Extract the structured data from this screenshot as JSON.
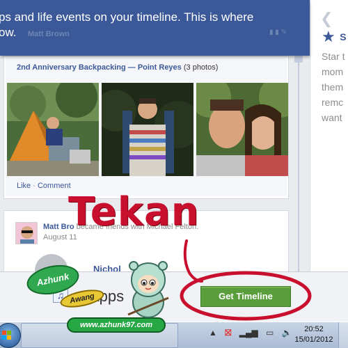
{
  "banner": {
    "line1": "ps and life events on your timeline. This is where",
    "line2": "ow.",
    "ghost_text": "Matt Brown"
  },
  "right_col": {
    "star_title": "S",
    "desc_lines": [
      "Star t",
      "mom",
      "them",
      "remc",
      "want"
    ]
  },
  "album": {
    "title": "2nd Anniversary Backpacking — Point Reyes",
    "count": "(3 photos)",
    "like": "Like",
    "comment": "Comment",
    "separator": "·"
  },
  "post": {
    "name": "Matt Bro",
    "rest": "became friends with Michael Felton.",
    "date": "August 11",
    "ghost_name": "Nichol"
  },
  "bottom": {
    "apps_label": "Apps",
    "get_timeline": "Get Timeline"
  },
  "overlay": {
    "tekan": "Tekan"
  },
  "watermark": {
    "name1": "Azhunk",
    "name2": "Awang",
    "url": "www.azhunk97.com"
  },
  "taskbar": {
    "time": "20:52",
    "date": "15/01/2012"
  },
  "colors": {
    "facebook_blue": "#3b5998",
    "button_green": "#5a9e3c",
    "annotation_red": "#c8102e"
  }
}
